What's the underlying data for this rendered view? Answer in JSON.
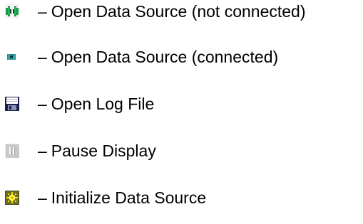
{
  "legend": {
    "items": [
      {
        "icon": "plug-disconnected-icon",
        "dash": "–",
        "label": "Open Data Source (not connected)"
      },
      {
        "icon": "connected-dot-icon",
        "dash": "–",
        "label": "Open Data Source (connected)"
      },
      {
        "icon": "floppy-disk-icon",
        "dash": "–",
        "label": "Open Log File"
      },
      {
        "icon": "pause-icon",
        "dash": "–",
        "label": "Pause Display"
      },
      {
        "icon": "sun-gear-icon",
        "dash": "–",
        "label": "Initialize Data Source"
      }
    ]
  },
  "colors": {
    "background": "#ffffff",
    "text": "#000000",
    "plug_green": "#1f9a4a",
    "connected_teal": "#2b8c8c",
    "floppy_navy": "#1b1f4f",
    "pause_gray": "#c8c8c8",
    "sun_yellow": "#f2e300"
  }
}
